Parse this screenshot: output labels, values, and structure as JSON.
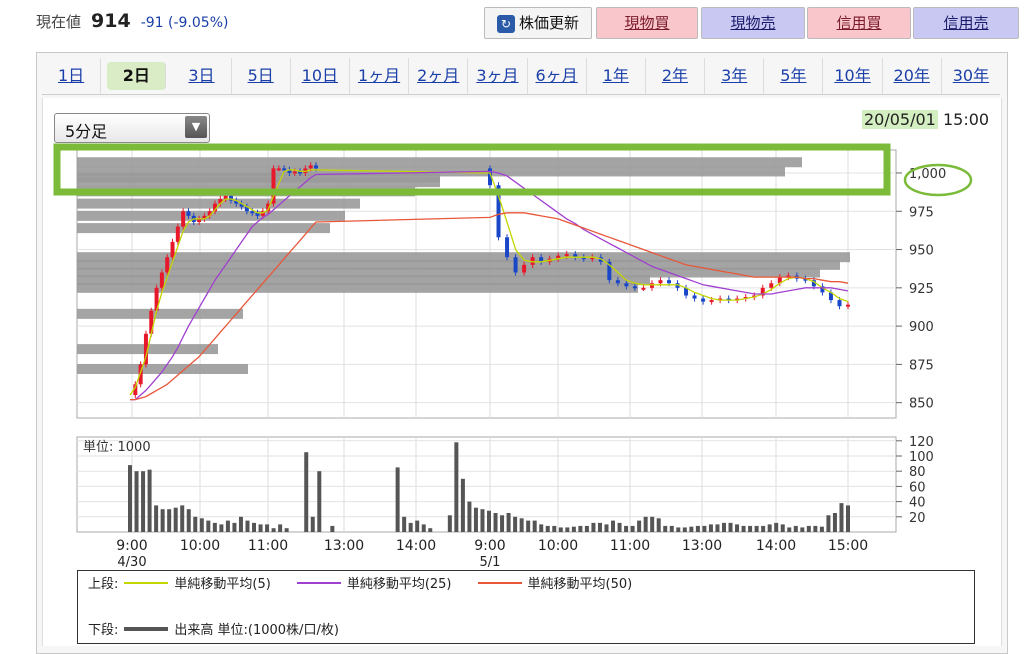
{
  "quote": {
    "label": "現在値",
    "price": "914",
    "change": "-91 (-9.05%)"
  },
  "buttons": {
    "refresh": "株価更新",
    "spot_buy": "現物買",
    "spot_sell": "現物売",
    "margin_buy": "信用買",
    "margin_sell": "信用売"
  },
  "tabs": [
    "1日",
    "2日",
    "3日",
    "5日",
    "10日",
    "1ヶ月",
    "2ヶ月",
    "3ヶ月",
    "6ヶ月",
    "1年",
    "2年",
    "3年",
    "5年",
    "10年",
    "20年",
    "30年"
  ],
  "active_tab": "2日",
  "interval_select": {
    "value": "5分足"
  },
  "timestamp": {
    "date": "20/05/01",
    "time": "15:00"
  },
  "colors": {
    "up": "#e8182b",
    "down": "#1a46c8",
    "sma5": "#c3d600",
    "sma25": "#a040d0",
    "sma50": "#e8573a",
    "volume": "#555555",
    "profile": "#9a9a9a",
    "highlight": "#7cbb3a"
  },
  "chart_data": [
    {
      "type": "candlestick",
      "ylim": [
        840,
        1015
      ],
      "yticks": [
        "1,000",
        "975",
        "950",
        "925",
        "900",
        "875",
        "850"
      ],
      "ytick_values": [
        1000,
        975,
        950,
        925,
        900,
        875,
        850
      ],
      "xticks": [
        "9:00",
        "10:00",
        "11:00",
        "13:00",
        "14:00",
        "9:00",
        "10:00",
        "11:00",
        "13:00",
        "14:00",
        "15:00"
      ],
      "date_labels": [
        {
          "label": "4/30",
          "tick": 0
        },
        {
          "label": "5/1",
          "tick": 5
        }
      ],
      "price_series": [
        855,
        862,
        875,
        895,
        910,
        925,
        935,
        945,
        955,
        965,
        975,
        972,
        968,
        970,
        972,
        975,
        980,
        983,
        985,
        982,
        980,
        978,
        975,
        974,
        972,
        975,
        980,
        1003,
        1003,
        1002,
        1000,
        1001,
        1000,
        1003,
        1005,
        1003,
        992,
        958,
        945,
        935,
        940,
        945,
        942,
        944,
        946,
        947,
        945,
        944,
        945,
        942,
        930,
        928,
        926,
        925,
        925,
        928,
        930,
        928,
        925,
        920,
        918,
        916,
        917,
        918,
        917,
        918,
        919,
        920,
        925,
        928,
        932,
        933,
        931,
        930,
        926,
        922,
        917,
        913,
        914
      ],
      "series": [
        {
          "name": "単純移動平均(5)",
          "values": [
            855,
            860,
            870,
            880,
            895,
            910,
            922,
            932,
            942,
            952,
            962,
            968,
            970,
            970,
            970,
            972,
            976,
            980,
            983,
            983,
            982,
            980,
            978,
            976,
            974,
            974,
            976,
            985,
            993,
            1001,
            1002,
            1002,
            1001,
            1001,
            1002,
            1002,
            1000,
            985,
            968,
            950,
            943,
            942,
            942,
            943,
            944,
            945,
            945,
            945,
            945,
            944,
            940,
            935,
            930,
            928,
            927,
            927,
            927,
            927,
            927,
            925,
            922,
            920,
            918,
            917,
            917,
            917,
            918,
            919,
            921,
            924,
            928,
            931,
            932,
            931,
            929,
            925,
            922,
            918,
            916
          ]
        },
        {
          "name": "単純移動平均(25)",
          "values": [
            852,
            852,
            855,
            858,
            862,
            866,
            870,
            875,
            880,
            886,
            893,
            900,
            906,
            912,
            918,
            924,
            930,
            935,
            940,
            945,
            950,
            955,
            960,
            965,
            968,
            971,
            973,
            976,
            979,
            982,
            985,
            988,
            991,
            994,
            997,
            999,
            1001,
            1000,
            998,
            994,
            990,
            986,
            982,
            978,
            974,
            970,
            967,
            963,
            960,
            957,
            954,
            951,
            948,
            945,
            942,
            939,
            937,
            935,
            933,
            931,
            929,
            927,
            926,
            925,
            924,
            923,
            922,
            921,
            921,
            921,
            922,
            923,
            924,
            925,
            925,
            925,
            925,
            924,
            923
          ]
        },
        {
          "name": "単純移動平均(50)",
          "values": [
            852,
            852,
            853,
            854,
            856,
            858,
            860,
            862,
            865,
            868,
            871,
            874,
            877,
            880,
            884,
            888,
            892,
            896,
            900,
            904,
            908,
            912,
            916,
            920,
            924,
            928,
            932,
            936,
            940,
            944,
            948,
            952,
            956,
            960,
            964,
            968,
            971,
            973,
            974,
            974,
            974,
            973,
            972,
            971,
            970,
            968,
            966,
            964,
            962,
            960,
            958,
            956,
            954,
            952,
            950,
            948,
            946,
            944,
            942,
            940,
            939,
            938,
            937,
            936,
            935,
            934,
            933,
            932,
            932,
            932,
            932,
            932,
            932,
            931,
            931,
            930,
            929,
            929,
            928
          ]
        }
      ]
    },
    {
      "type": "bar",
      "unit_label": "単位: 1000",
      "ylim": [
        0,
        125
      ],
      "yticks": [
        "120",
        "100",
        "80",
        "60",
        "40",
        "20"
      ],
      "ytick_values": [
        120,
        100,
        80,
        60,
        40,
        20
      ],
      "values": [
        88,
        80,
        80,
        82,
        35,
        30,
        30,
        32,
        35,
        30,
        20,
        18,
        15,
        12,
        10,
        15,
        12,
        20,
        15,
        12,
        10,
        10,
        5,
        10,
        5,
        0,
        0,
        105,
        20,
        80,
        0,
        8,
        0,
        0,
        0,
        0,
        0,
        0,
        0,
        0,
        0,
        85,
        20,
        12,
        15,
        10,
        5,
        0,
        0,
        22,
        118,
        70,
        40,
        32,
        30,
        28,
        25,
        22,
        25,
        20,
        18,
        15,
        15,
        10,
        8,
        8,
        6,
        6,
        7,
        8,
        8,
        12,
        12,
        10,
        15,
        12,
        8,
        8,
        15,
        20,
        20,
        18,
        8,
        8,
        6,
        6,
        7,
        8,
        8,
        10,
        10,
        12,
        12,
        10,
        8,
        8,
        8,
        8,
        10,
        12,
        10,
        6,
        8,
        6,
        8,
        8,
        7,
        22,
        25,
        38,
        35
      ]
    }
  ],
  "legend": {
    "upper_label": "上段:",
    "upper_items": [
      "単純移動平均(5)",
      "単純移動平均(25)",
      "単純移動平均(50)"
    ],
    "lower_label": "下段:",
    "lower_item": "出来高 単位:(1000株/口/枚)"
  }
}
